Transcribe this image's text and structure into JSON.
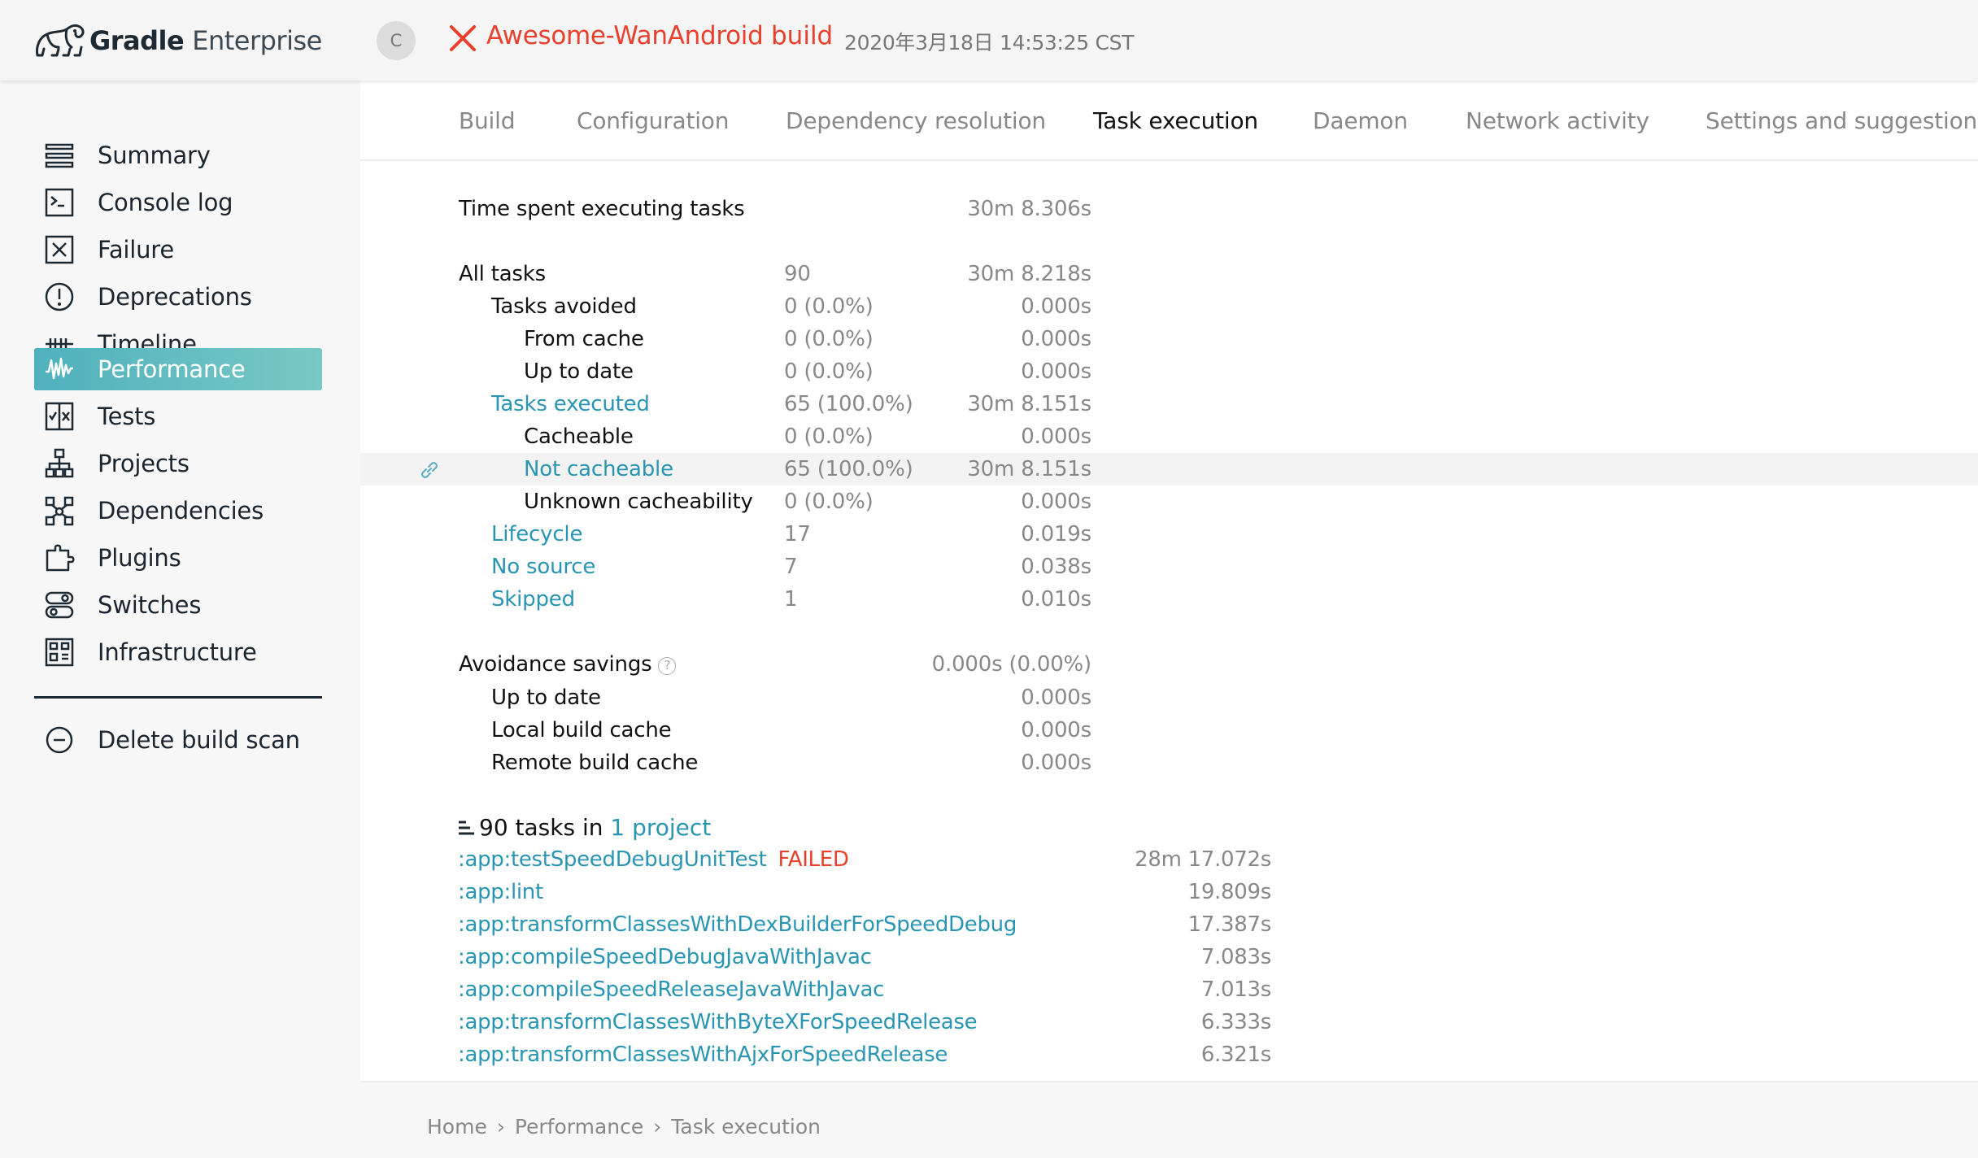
{
  "header": {
    "logo_gradle": "Gradle",
    "logo_enterprise": "Enterprise",
    "avatar_initial": "C",
    "project_name": "Awesome-WanAndroid",
    "task_name": "build",
    "build_time": "2020年3月18日 14:53:25 CST",
    "status": "failed",
    "status_color": "#e8402c"
  },
  "sidebar": {
    "items": [
      {
        "label": "Summary",
        "icon": "summary-icon"
      },
      {
        "label": "Console log",
        "icon": "console-icon"
      },
      {
        "label": "Failure",
        "icon": "failure-icon"
      },
      {
        "label": "Deprecations",
        "icon": "deprecations-icon"
      },
      {
        "label": "Timeline",
        "icon": "timeline-icon"
      },
      {
        "label": "Performance",
        "icon": "performance-icon",
        "active": true
      },
      {
        "label": "Tests",
        "icon": "tests-icon"
      },
      {
        "label": "Projects",
        "icon": "projects-icon"
      },
      {
        "label": "Dependencies",
        "icon": "dependencies-icon"
      },
      {
        "label": "Plugins",
        "icon": "plugins-icon"
      },
      {
        "label": "Switches",
        "icon": "switches-icon"
      },
      {
        "label": "Infrastructure",
        "icon": "infrastructure-icon"
      }
    ],
    "delete_label": "Delete build scan",
    "active_color": "#4fb1bd"
  },
  "tabs": [
    {
      "label": "Build"
    },
    {
      "label": "Configuration"
    },
    {
      "label": "Dependency resolution"
    },
    {
      "label": "Task execution",
      "active": true
    },
    {
      "label": "Daemon"
    },
    {
      "label": "Network activity"
    },
    {
      "label": "Settings and suggestions"
    }
  ],
  "stats": {
    "time_spent": {
      "label": "Time spent executing tasks",
      "time": "30m 8.306s"
    },
    "rows": [
      {
        "label": "All tasks",
        "count": "90",
        "time": "30m 8.218s"
      },
      {
        "label": "Tasks avoided",
        "count": "0 (0.0%)",
        "time": "0.000s"
      },
      {
        "label": "From cache",
        "count": "0 (0.0%)",
        "time": "0.000s"
      },
      {
        "label": "Up to date",
        "count": "0 (0.0%)",
        "time": "0.000s"
      },
      {
        "label": "Tasks executed",
        "count": "65 (100.0%)",
        "time": "30m 8.151s"
      },
      {
        "label": "Cacheable",
        "count": "0 (0.0%)",
        "time": "0.000s"
      },
      {
        "label": "Not cacheable",
        "count": "65 (100.0%)",
        "time": "30m 8.151s"
      },
      {
        "label": "Unknown cacheability",
        "count": "0 (0.0%)",
        "time": "0.000s"
      },
      {
        "label": "Lifecycle",
        "count": "17",
        "time": "0.019s"
      },
      {
        "label": "No source",
        "count": "7",
        "time": "0.038s"
      },
      {
        "label": "Skipped",
        "count": "1",
        "time": "0.010s"
      }
    ],
    "avoidance": {
      "label": "Avoidance savings",
      "time": "0.000s (0.00%)"
    },
    "avoidance_rows": [
      {
        "label": "Up to date",
        "time": "0.000s"
      },
      {
        "label": "Local build cache",
        "time": "0.000s"
      },
      {
        "label": "Remote build cache",
        "time": "0.000s"
      }
    ]
  },
  "tasks": {
    "header_prefix": "90 tasks in",
    "header_link": "1 project",
    "items": [
      {
        "name": ":app:testSpeedDebugUnitTest",
        "status": "FAILED",
        "time": "28m 17.072s"
      },
      {
        "name": ":app:lint",
        "status": "",
        "time": "19.809s"
      },
      {
        "name": ":app:transformClassesWithDexBuilderForSpeedDebug",
        "status": "",
        "time": "17.387s"
      },
      {
        "name": ":app:compileSpeedDebugJavaWithJavac",
        "status": "",
        "time": "7.083s"
      },
      {
        "name": ":app:compileSpeedReleaseJavaWithJavac",
        "status": "",
        "time": "7.013s"
      },
      {
        "name": ":app:transformClassesWithByteXForSpeedRelease",
        "status": "",
        "time": "6.333s"
      },
      {
        "name": ":app:transformClassesWithAjxForSpeedRelease",
        "status": "",
        "time": "6.321s"
      }
    ]
  },
  "breadcrumb": {
    "items": [
      "Home",
      "Performance",
      "Task execution"
    ],
    "separator": "›"
  },
  "colors": {
    "link": "#2a95b3",
    "error": "#e8402c",
    "muted": "#888888"
  }
}
